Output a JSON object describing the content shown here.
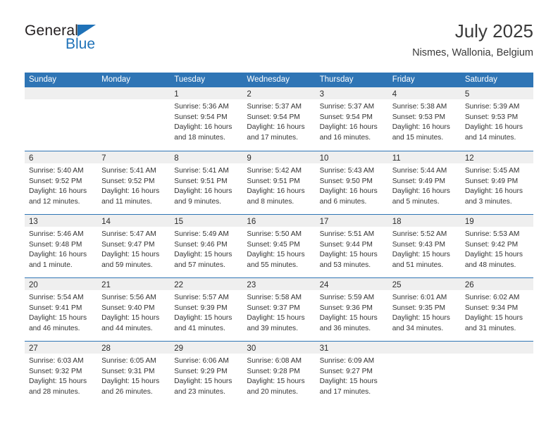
{
  "brand": {
    "name_top": "General",
    "name_bottom": "Blue",
    "accent_color": "#1f72b8"
  },
  "header": {
    "title": "July 2025",
    "subtitle": "Nismes, Wallonia, Belgium"
  },
  "theme": {
    "header_blue": "#2f75b5",
    "daynum_band": "#efefef",
    "text": "#333333"
  },
  "weekdays": [
    "Sunday",
    "Monday",
    "Tuesday",
    "Wednesday",
    "Thursday",
    "Friday",
    "Saturday"
  ],
  "weeks": [
    [
      {
        "day": "",
        "lines": []
      },
      {
        "day": "",
        "lines": []
      },
      {
        "day": "1",
        "lines": [
          "Sunrise: 5:36 AM",
          "Sunset: 9:54 PM",
          "Daylight: 16 hours",
          "and 18 minutes."
        ]
      },
      {
        "day": "2",
        "lines": [
          "Sunrise: 5:37 AM",
          "Sunset: 9:54 PM",
          "Daylight: 16 hours",
          "and 17 minutes."
        ]
      },
      {
        "day": "3",
        "lines": [
          "Sunrise: 5:37 AM",
          "Sunset: 9:54 PM",
          "Daylight: 16 hours",
          "and 16 minutes."
        ]
      },
      {
        "day": "4",
        "lines": [
          "Sunrise: 5:38 AM",
          "Sunset: 9:53 PM",
          "Daylight: 16 hours",
          "and 15 minutes."
        ]
      },
      {
        "day": "5",
        "lines": [
          "Sunrise: 5:39 AM",
          "Sunset: 9:53 PM",
          "Daylight: 16 hours",
          "and 14 minutes."
        ]
      }
    ],
    [
      {
        "day": "6",
        "lines": [
          "Sunrise: 5:40 AM",
          "Sunset: 9:52 PM",
          "Daylight: 16 hours",
          "and 12 minutes."
        ]
      },
      {
        "day": "7",
        "lines": [
          "Sunrise: 5:41 AM",
          "Sunset: 9:52 PM",
          "Daylight: 16 hours",
          "and 11 minutes."
        ]
      },
      {
        "day": "8",
        "lines": [
          "Sunrise: 5:41 AM",
          "Sunset: 9:51 PM",
          "Daylight: 16 hours",
          "and 9 minutes."
        ]
      },
      {
        "day": "9",
        "lines": [
          "Sunrise: 5:42 AM",
          "Sunset: 9:51 PM",
          "Daylight: 16 hours",
          "and 8 minutes."
        ]
      },
      {
        "day": "10",
        "lines": [
          "Sunrise: 5:43 AM",
          "Sunset: 9:50 PM",
          "Daylight: 16 hours",
          "and 6 minutes."
        ]
      },
      {
        "day": "11",
        "lines": [
          "Sunrise: 5:44 AM",
          "Sunset: 9:49 PM",
          "Daylight: 16 hours",
          "and 5 minutes."
        ]
      },
      {
        "day": "12",
        "lines": [
          "Sunrise: 5:45 AM",
          "Sunset: 9:49 PM",
          "Daylight: 16 hours",
          "and 3 minutes."
        ]
      }
    ],
    [
      {
        "day": "13",
        "lines": [
          "Sunrise: 5:46 AM",
          "Sunset: 9:48 PM",
          "Daylight: 16 hours",
          "and 1 minute."
        ]
      },
      {
        "day": "14",
        "lines": [
          "Sunrise: 5:47 AM",
          "Sunset: 9:47 PM",
          "Daylight: 15 hours",
          "and 59 minutes."
        ]
      },
      {
        "day": "15",
        "lines": [
          "Sunrise: 5:49 AM",
          "Sunset: 9:46 PM",
          "Daylight: 15 hours",
          "and 57 minutes."
        ]
      },
      {
        "day": "16",
        "lines": [
          "Sunrise: 5:50 AM",
          "Sunset: 9:45 PM",
          "Daylight: 15 hours",
          "and 55 minutes."
        ]
      },
      {
        "day": "17",
        "lines": [
          "Sunrise: 5:51 AM",
          "Sunset: 9:44 PM",
          "Daylight: 15 hours",
          "and 53 minutes."
        ]
      },
      {
        "day": "18",
        "lines": [
          "Sunrise: 5:52 AM",
          "Sunset: 9:43 PM",
          "Daylight: 15 hours",
          "and 51 minutes."
        ]
      },
      {
        "day": "19",
        "lines": [
          "Sunrise: 5:53 AM",
          "Sunset: 9:42 PM",
          "Daylight: 15 hours",
          "and 48 minutes."
        ]
      }
    ],
    [
      {
        "day": "20",
        "lines": [
          "Sunrise: 5:54 AM",
          "Sunset: 9:41 PM",
          "Daylight: 15 hours",
          "and 46 minutes."
        ]
      },
      {
        "day": "21",
        "lines": [
          "Sunrise: 5:56 AM",
          "Sunset: 9:40 PM",
          "Daylight: 15 hours",
          "and 44 minutes."
        ]
      },
      {
        "day": "22",
        "lines": [
          "Sunrise: 5:57 AM",
          "Sunset: 9:39 PM",
          "Daylight: 15 hours",
          "and 41 minutes."
        ]
      },
      {
        "day": "23",
        "lines": [
          "Sunrise: 5:58 AM",
          "Sunset: 9:37 PM",
          "Daylight: 15 hours",
          "and 39 minutes."
        ]
      },
      {
        "day": "24",
        "lines": [
          "Sunrise: 5:59 AM",
          "Sunset: 9:36 PM",
          "Daylight: 15 hours",
          "and 36 minutes."
        ]
      },
      {
        "day": "25",
        "lines": [
          "Sunrise: 6:01 AM",
          "Sunset: 9:35 PM",
          "Daylight: 15 hours",
          "and 34 minutes."
        ]
      },
      {
        "day": "26",
        "lines": [
          "Sunrise: 6:02 AM",
          "Sunset: 9:34 PM",
          "Daylight: 15 hours",
          "and 31 minutes."
        ]
      }
    ],
    [
      {
        "day": "27",
        "lines": [
          "Sunrise: 6:03 AM",
          "Sunset: 9:32 PM",
          "Daylight: 15 hours",
          "and 28 minutes."
        ]
      },
      {
        "day": "28",
        "lines": [
          "Sunrise: 6:05 AM",
          "Sunset: 9:31 PM",
          "Daylight: 15 hours",
          "and 26 minutes."
        ]
      },
      {
        "day": "29",
        "lines": [
          "Sunrise: 6:06 AM",
          "Sunset: 9:29 PM",
          "Daylight: 15 hours",
          "and 23 minutes."
        ]
      },
      {
        "day": "30",
        "lines": [
          "Sunrise: 6:08 AM",
          "Sunset: 9:28 PM",
          "Daylight: 15 hours",
          "and 20 minutes."
        ]
      },
      {
        "day": "31",
        "lines": [
          "Sunrise: 6:09 AM",
          "Sunset: 9:27 PM",
          "Daylight: 15 hours",
          "and 17 minutes."
        ]
      },
      {
        "day": "",
        "lines": []
      },
      {
        "day": "",
        "lines": []
      }
    ]
  ]
}
